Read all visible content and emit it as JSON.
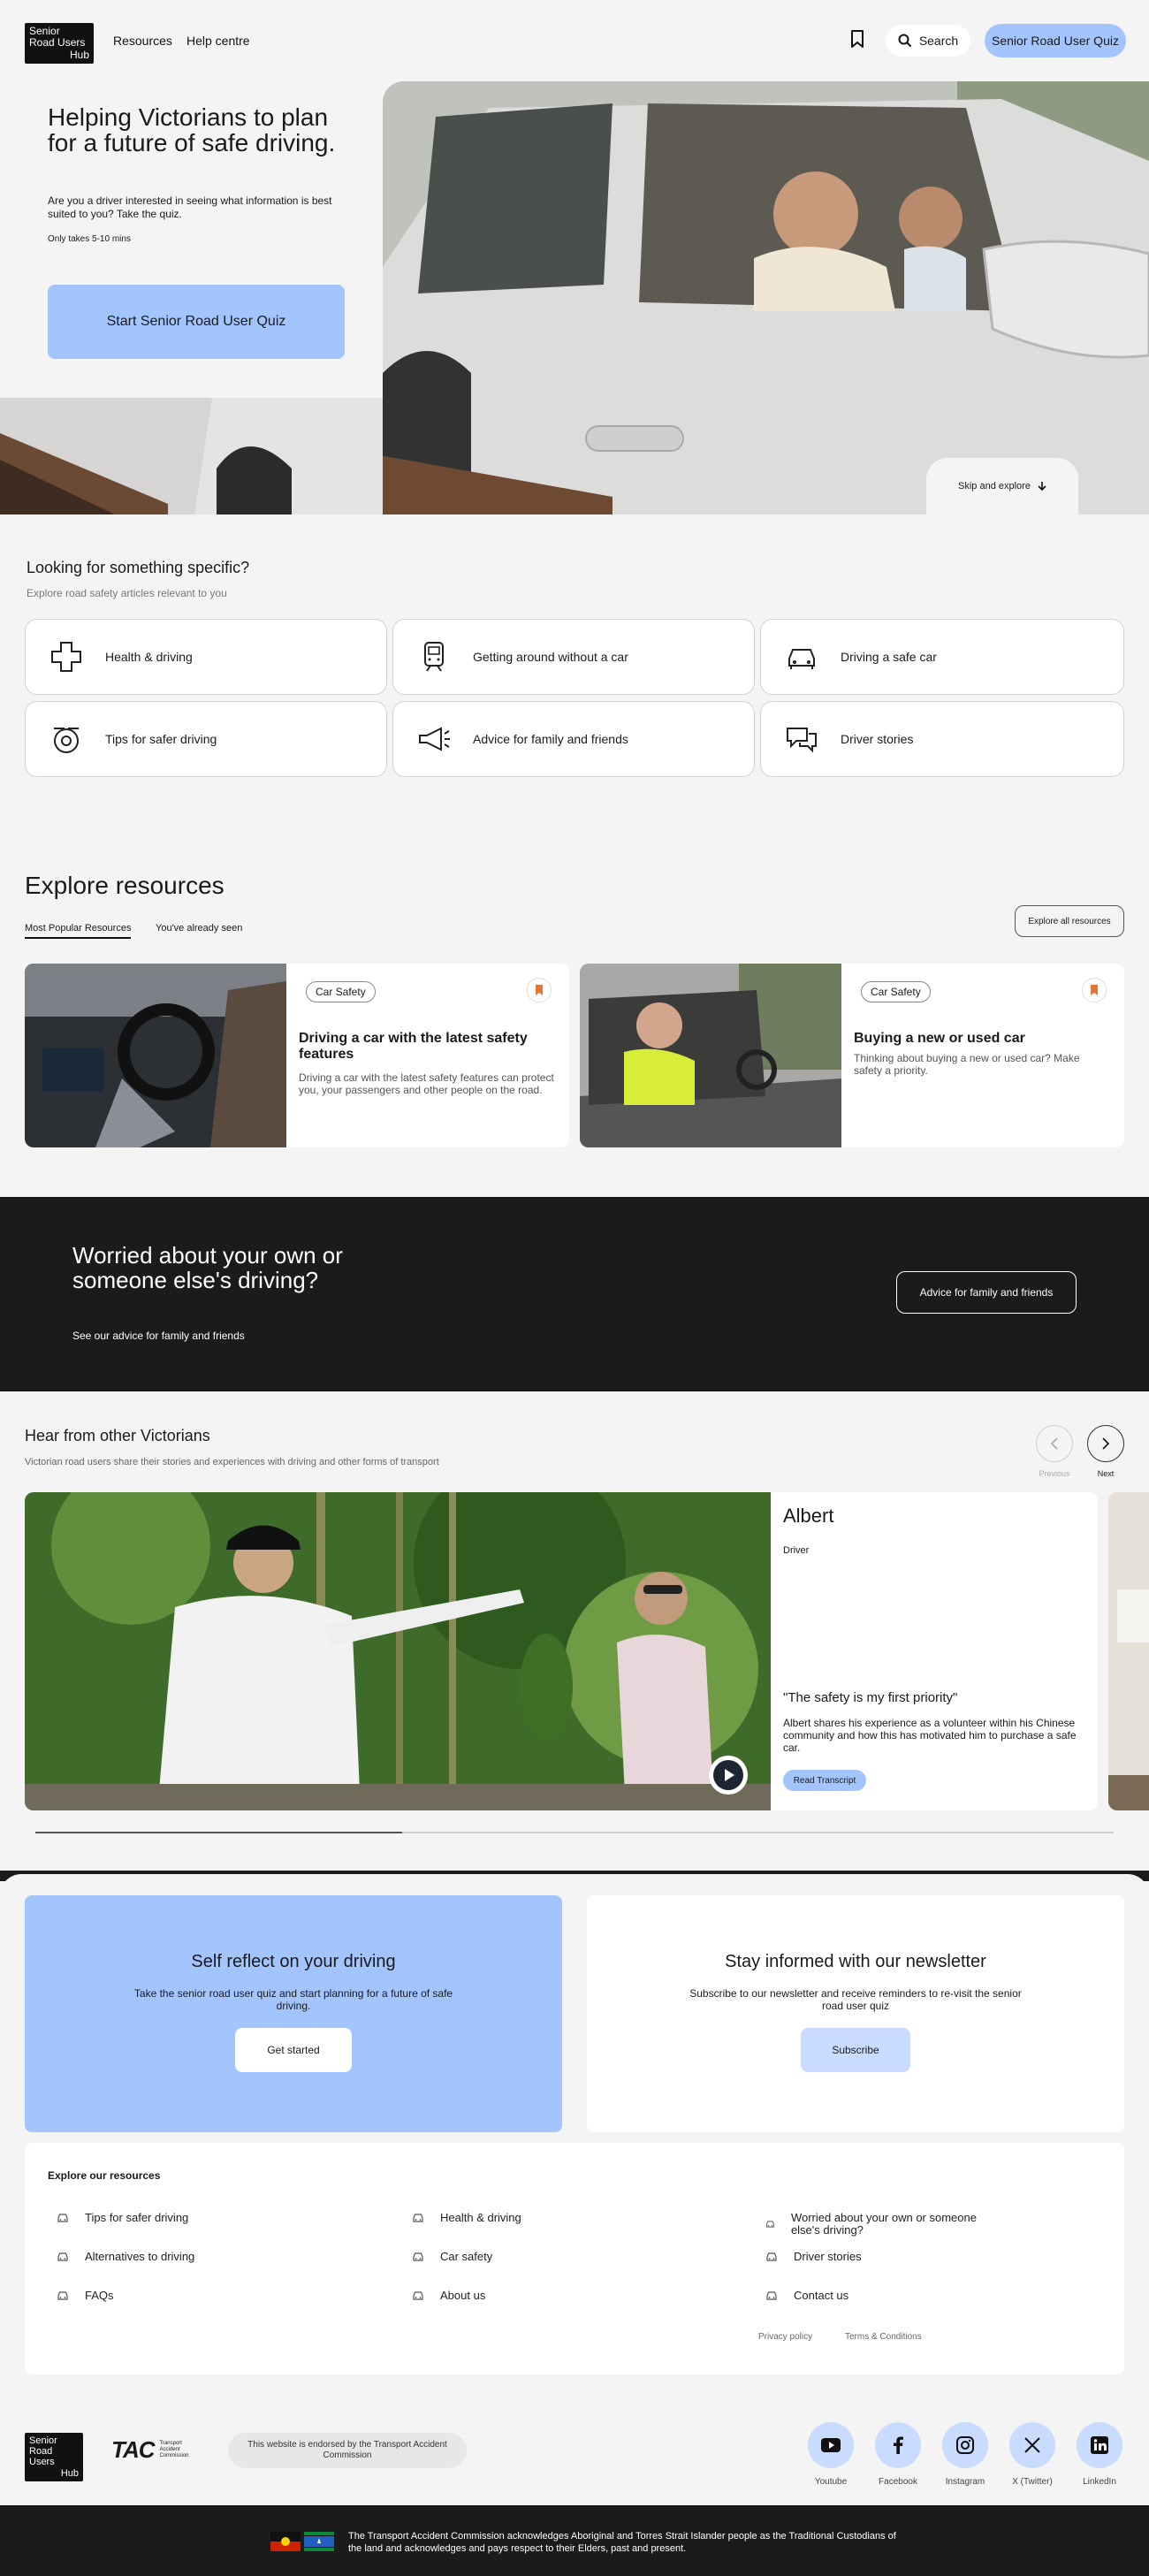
{
  "header": {
    "logo_lines": [
      "Senior",
      "Road Users",
      "Hub"
    ],
    "nav": [
      "Resources",
      "Help centre"
    ],
    "search_label": "Search",
    "quiz_button": "Senior Road User Quiz"
  },
  "hero": {
    "title": "Helping Victorians to plan for a future of safe driving.",
    "description": "Are you a driver interested in seeing what information is best suited to you? Take the quiz.",
    "duration": "Only takes 5-10 mins",
    "cta": "Start Senior Road User Quiz",
    "skip": "Skip and explore"
  },
  "specific": {
    "title": "Looking for something specific?",
    "subtitle": "Explore road safety articles relevant to you",
    "categories": [
      {
        "label": "Health & driving",
        "icon": "plus-cross-icon"
      },
      {
        "label": "Getting around without a car",
        "icon": "train-icon"
      },
      {
        "label": "Driving a safe car",
        "icon": "car-icon"
      },
      {
        "label": "Tips for safer driving",
        "icon": "steering-wheel-icon"
      },
      {
        "label": "Advice for family and friends",
        "icon": "megaphone-icon"
      },
      {
        "label": "Driver stories",
        "icon": "chat-bubbles-icon"
      }
    ]
  },
  "resources": {
    "title": "Explore resources",
    "tabs": [
      "Most Popular Resources",
      "You've already seen"
    ],
    "explore_all": "Explore all resources",
    "cards": [
      {
        "tag": "Car Safety",
        "title": "Driving a car with the latest safety features",
        "body": "Driving a car with the latest safety features can protect you, your passengers and other people on the road."
      },
      {
        "tag": "Car Safety",
        "title": "Buying a new or used car",
        "body": "Thinking about buying a new or used car? Make safety a priority."
      }
    ]
  },
  "worried": {
    "title": "Worried about your own or someone else's driving?",
    "subtitle": "See our advice for family and friends",
    "button": "Advice for family and friends"
  },
  "stories": {
    "title": "Hear from other Victorians",
    "subtitle": "Victorian road users share their stories and experiences with driving and other forms of transport",
    "prev": "Previous",
    "next": "Next",
    "name": "Albert",
    "role": "Driver",
    "quote": "\"The safety is my first priority\"",
    "body": "Albert shares his experience as a volunteer within his Chinese community and how this has motivated him to purchase a safe car.",
    "transcript": "Read Transcript",
    "progress": 0.34
  },
  "reflect": {
    "title": "Self reflect on your driving",
    "body": "Take the senior road user quiz and start planning for a future of safe driving.",
    "button": "Get started"
  },
  "newsletter": {
    "title": "Stay informed with our newsletter",
    "body": "Subscribe to our newsletter and receive reminders to re-visit the senior road user quiz",
    "button": "Subscribe"
  },
  "footer": {
    "heading": "Explore our resources",
    "links": [
      "Tips for safer driving",
      "Health & driving",
      "Worried about your own or someone else's driving?",
      "Alternatives to driving",
      "Car safety",
      "Driver stories",
      "FAQs",
      "About us",
      "Contact us"
    ],
    "privacy": "Privacy policy",
    "terms": "Terms & Conditions",
    "tac_word": "TAC",
    "tac_lines": [
      "Transport",
      "Accident",
      "Commission"
    ],
    "endorsed": "This website is endorsed by the Transport Accident Commission",
    "social": [
      "Youtube",
      "Facebook",
      "Instagram",
      "X (Twitter)",
      "LinkedIn"
    ],
    "acknowledgement": "The Transport Accident Commission acknowledges Aboriginal and Torres Strait Islander people as the Traditional Custodians of the land and acknowledges and pays respect to their Elders, past and present."
  },
  "colors": {
    "accent": "#a3c5ff",
    "dark": "#1b1b1b",
    "bookmark": "#e0783a"
  }
}
